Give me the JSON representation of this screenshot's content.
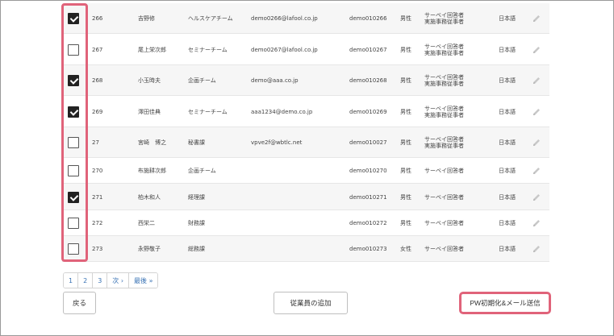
{
  "rows": [
    {
      "checked": true,
      "id": "266",
      "name": "吉野修",
      "team": "ヘルスケアチーム",
      "email": "demo0266@lafool.co.jp",
      "login": "demo010266",
      "gender": "男性",
      "role1": "サーベイ回答者",
      "role2": "実施事務従事者",
      "lang": "日本語"
    },
    {
      "checked": false,
      "id": "267",
      "name": "尾上栄次郎",
      "team": "セミナーチーム",
      "email": "demo0267@lafool.co.jp",
      "login": "demo010267",
      "gender": "男性",
      "role1": "サーベイ回答者",
      "role2": "実施事務従事者",
      "lang": "日本語"
    },
    {
      "checked": true,
      "id": "268",
      "name": "小玉時夫",
      "team": "企画チーム",
      "email": "demo@aaa.co.jp",
      "login": "demo010268",
      "gender": "男性",
      "role1": "サーベイ回答者",
      "role2": "実施事務従事者",
      "lang": "日本語"
    },
    {
      "checked": true,
      "id": "269",
      "name": "澤田佳典",
      "team": "セミナーチーム",
      "email": "aaa1234@demo.co.jp",
      "login": "demo010269",
      "gender": "男性",
      "role1": "サーベイ回答者",
      "role2": "実施事務従事者",
      "lang": "日本語"
    },
    {
      "checked": false,
      "id": "27",
      "name": "宮崎　博之",
      "team": "秘書課",
      "email": "vpve2f@wbtlc.net",
      "login": "demo010027",
      "gender": "男性",
      "role1": "サーベイ回答者",
      "role2": "実施事務従事者",
      "lang": "日本語"
    },
    {
      "checked": false,
      "id": "270",
      "name": "布施耕次郎",
      "team": "企画チーム",
      "email": "",
      "login": "demo010270",
      "gender": "男性",
      "role1": "サーベイ回答者",
      "role2": "",
      "lang": "日本語"
    },
    {
      "checked": true,
      "id": "271",
      "name": "柏木和人",
      "team": "経理課",
      "email": "",
      "login": "demo010271",
      "gender": "男性",
      "role1": "サーベイ回答者",
      "role2": "",
      "lang": "日本語"
    },
    {
      "checked": false,
      "id": "272",
      "name": "西栄二",
      "team": "財務課",
      "email": "",
      "login": "demo010272",
      "gender": "男性",
      "role1": "サーベイ回答者",
      "role2": "",
      "lang": "日本語"
    },
    {
      "checked": false,
      "id": "273",
      "name": "永野敬子",
      "team": "総務課",
      "email": "",
      "login": "demo010273",
      "gender": "女性",
      "role1": "サーベイ回答者",
      "role2": "",
      "lang": "日本語"
    }
  ],
  "pagination": [
    "1",
    "2",
    "3",
    "次 ›",
    "最後 »"
  ],
  "buttons": {
    "back": "戻る",
    "add_employee": "従業員の追加",
    "pw_reset": "PW初期化&メール送信"
  },
  "icons": {
    "edit": "pencil-icon"
  },
  "colors": {
    "highlight": "#e0637a",
    "link": "#3a73b5",
    "checkbox_checked": "#222222"
  }
}
